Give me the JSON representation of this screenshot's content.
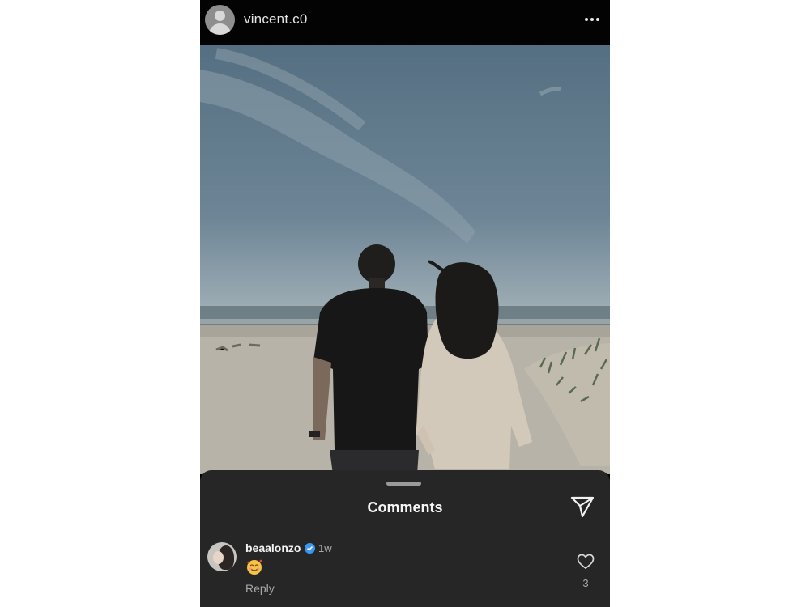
{
  "post": {
    "username": "vincent.c0",
    "more_icon": "more-horizontal-icon",
    "image_alt": "Couple walking on a beach toward the sea"
  },
  "comments_sheet": {
    "title": "Comments",
    "share_icon": "paper-plane-icon",
    "comments": [
      {
        "username": "beaalonzo",
        "verified": true,
        "time": "1w",
        "text_emoji": "smiling-face-with-hearts",
        "reply_label": "Reply",
        "like_icon": "heart-outline-icon",
        "like_count": "3"
      }
    ]
  },
  "colors": {
    "header_bg": "#030303",
    "sheet_bg": "#262626",
    "verified_blue": "#3897f0",
    "text_primary": "#f2f2f2",
    "text_secondary": "#a8a8a8"
  }
}
